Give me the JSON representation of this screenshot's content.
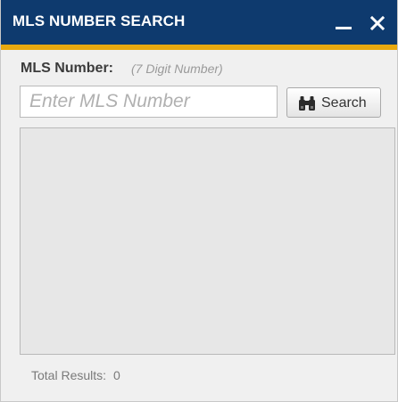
{
  "window": {
    "title": "MLS NUMBER SEARCH",
    "minimize_icon": "minimize-icon",
    "close_icon": "close-icon"
  },
  "colors": {
    "titlebar": "#0e3a6e",
    "accent": "#e8a90f",
    "panel": "#e7e7e7"
  },
  "form": {
    "label": "MLS Number:",
    "hint": "(7 Digit Number)",
    "input_value": "",
    "input_placeholder": "Enter MLS Number",
    "search_label": "Search",
    "search_icon": "binoculars-icon"
  },
  "results": {
    "items": []
  },
  "footer": {
    "total_label": "Total Results:",
    "total_count": "0"
  }
}
